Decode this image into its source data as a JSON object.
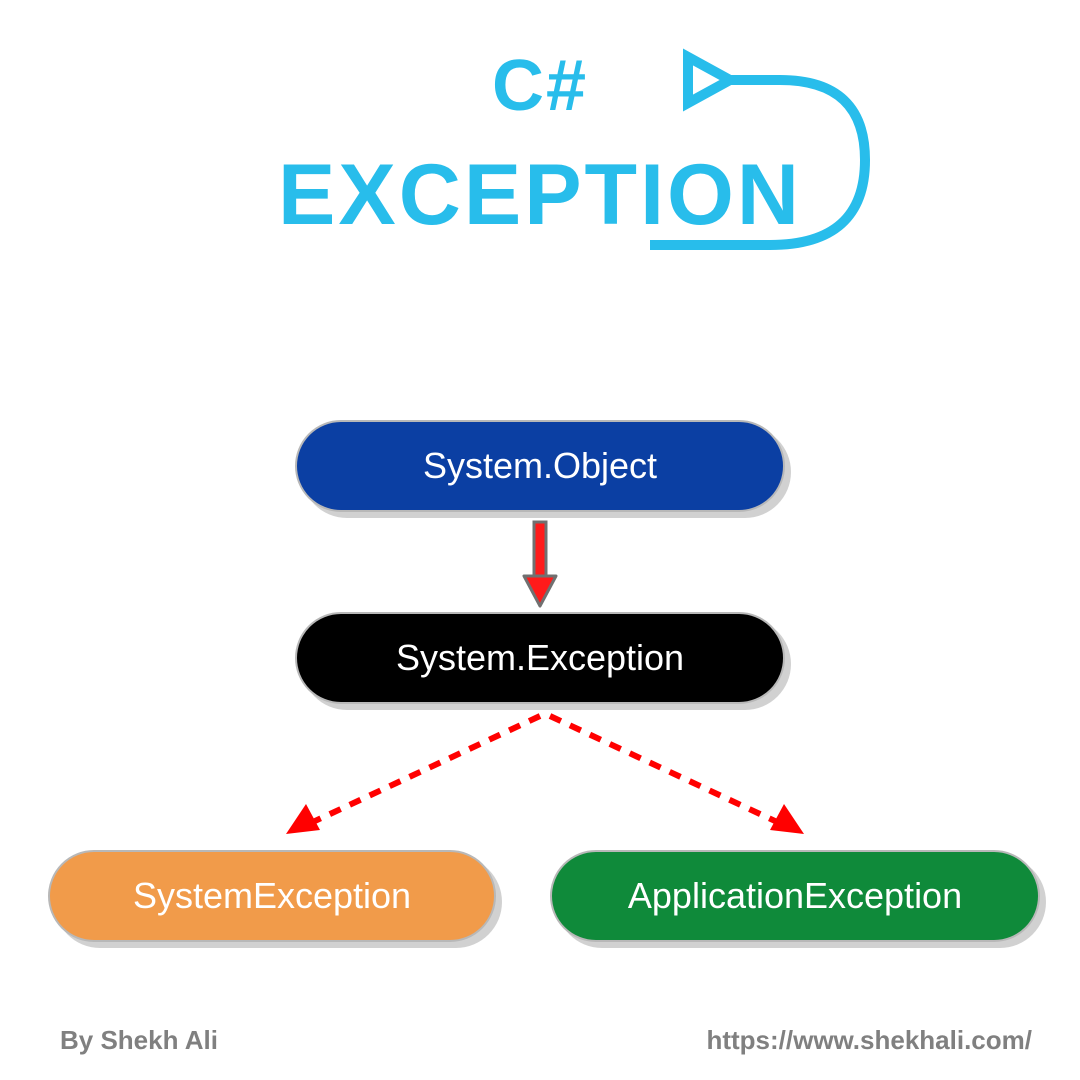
{
  "title": {
    "line1": "C#",
    "line2": "EXCEPTION"
  },
  "nodes": {
    "object": "System.Object",
    "exception": "System.Exception",
    "systemException": "SystemException",
    "applicationException": "ApplicationException"
  },
  "footer": {
    "author": "By Shekh Ali",
    "url": "https://www.shekhali.com/"
  },
  "colors": {
    "accent": "#28bdeb",
    "nodeObject": "#0b3fa3",
    "nodeException": "#000000",
    "nodeSystem": "#f19b4a",
    "nodeApp": "#0f8a3a",
    "arrowRed": "#ff1a1a",
    "arrowRedStroke": "#ff0000",
    "footerGray": "#808080"
  }
}
